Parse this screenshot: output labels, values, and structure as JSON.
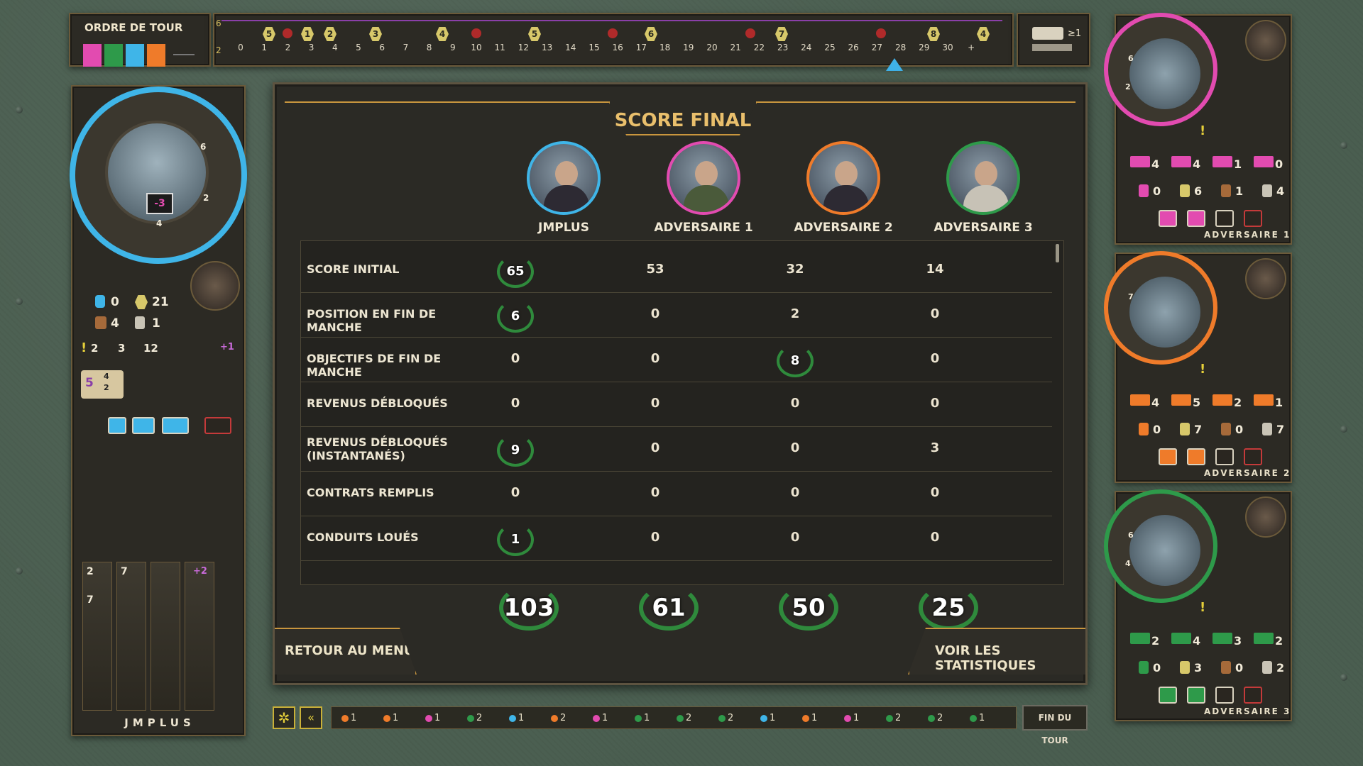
{
  "top_bar": {
    "turn_order_title": "ORDRE DE TOUR",
    "turn_order_colors": [
      "#e24bb0",
      "#2e9a4a",
      "#3fb5e8",
      "#ef7b2a"
    ],
    "round_markers": [
      "6",
      "2"
    ],
    "track_numbers": [
      "0",
      "1",
      "2",
      "3",
      "4",
      "5",
      "6",
      "7",
      "8",
      "9",
      "10",
      "11",
      "12",
      "13",
      "14",
      "15",
      "16",
      "17",
      "18",
      "19",
      "20",
      "21",
      "22",
      "23",
      "24",
      "25",
      "26",
      "27",
      "28",
      "29",
      "30",
      "+"
    ],
    "track_bonus_labels": [
      "5",
      "3",
      "1",
      "2",
      "3",
      "4",
      "5",
      "6",
      "7",
      "8",
      "4"
    ],
    "right_widget_text": "≥1"
  },
  "score_dialog": {
    "title": "SCORE FINAL",
    "players": [
      {
        "name": "JMPLUS",
        "color": "#3fb5e8"
      },
      {
        "name": "ADVERSAIRE 1",
        "color": "#e24bb0"
      },
      {
        "name": "ADVERSAIRE 2",
        "color": "#ef7b2a"
      },
      {
        "name": "ADVERSAIRE 3",
        "color": "#2e9a4a"
      }
    ],
    "rows": [
      {
        "label": "SCORE INITIAL",
        "values": [
          "65",
          "53",
          "32",
          "14"
        ],
        "laurel": [
          true,
          false,
          false,
          false
        ]
      },
      {
        "label": "POSITION EN FIN DE MANCHE",
        "values": [
          "6",
          "0",
          "2",
          "0"
        ],
        "laurel": [
          true,
          false,
          false,
          false
        ]
      },
      {
        "label": "OBJECTIFS DE FIN DE MANCHE",
        "values": [
          "0",
          "0",
          "8",
          "0"
        ],
        "laurel": [
          false,
          false,
          true,
          false
        ]
      },
      {
        "label": "REVENUS DÉBLOQUÉS",
        "values": [
          "0",
          "0",
          "0",
          "0"
        ],
        "laurel": [
          false,
          false,
          false,
          false
        ]
      },
      {
        "label": "REVENUS DÉBLOQUÉS (INSTANTANÉS)",
        "values": [
          "9",
          "0",
          "0",
          "3"
        ],
        "laurel": [
          true,
          false,
          false,
          false
        ]
      },
      {
        "label": "CONTRATS REMPLIS",
        "values": [
          "0",
          "0",
          "0",
          "0"
        ],
        "laurel": [
          false,
          false,
          false,
          false
        ]
      },
      {
        "label": "CONDUITS LOUÉS",
        "values": [
          "1",
          "0",
          "0",
          "0"
        ],
        "laurel": [
          true,
          false,
          false,
          false
        ]
      }
    ],
    "totals": [
      "103",
      "61",
      "50",
      "25"
    ],
    "btn_menu": "RETOUR AU MENU",
    "btn_stats": "VOIR LES STATISTIQUES"
  },
  "left_panel": {
    "player_name": "JMPLUS",
    "wheel_numbers": [
      "6",
      "2",
      "4"
    ],
    "wheel_center_value": "-3",
    "stats": {
      "workers": "0",
      "gold": "21",
      "engineers": "4",
      "excavators": "1",
      "alert": "2",
      "resource_a": "3",
      "resource_b": "12",
      "bonus": "+1"
    },
    "card_value": "5",
    "card_sub": [
      "4",
      "2"
    ],
    "pillar_values": [
      "2",
      "7",
      "7",
      "+2"
    ]
  },
  "bottom_bar": {
    "history": [
      "1",
      "1",
      "1",
      "2",
      "1",
      "2",
      "1",
      "1",
      "2",
      "2",
      "1",
      "1",
      "1",
      "2",
      "2",
      "1"
    ],
    "end_turn_label": "FIN DU TOUR"
  },
  "opponents": [
    {
      "name": "ADVERSAIRE 1",
      "color": "#e24bb0",
      "structures": [
        "4",
        "4",
        "1",
        "0"
      ],
      "resources": [
        "0",
        "6",
        "1",
        "4"
      ],
      "wheel_numbers": [
        "6",
        "2"
      ]
    },
    {
      "name": "ADVERSAIRE 2",
      "color": "#ef7b2a",
      "structures": [
        "4",
        "5",
        "2",
        "1"
      ],
      "resources": [
        "0",
        "7",
        "0",
        "7"
      ],
      "wheel_numbers": [
        "7"
      ]
    },
    {
      "name": "ADVERSAIRE 3",
      "color": "#2e9a4a",
      "structures": [
        "2",
        "4",
        "3",
        "2"
      ],
      "resources": [
        "0",
        "3",
        "0",
        "2"
      ],
      "wheel_numbers": [
        "6",
        "4"
      ]
    }
  ]
}
